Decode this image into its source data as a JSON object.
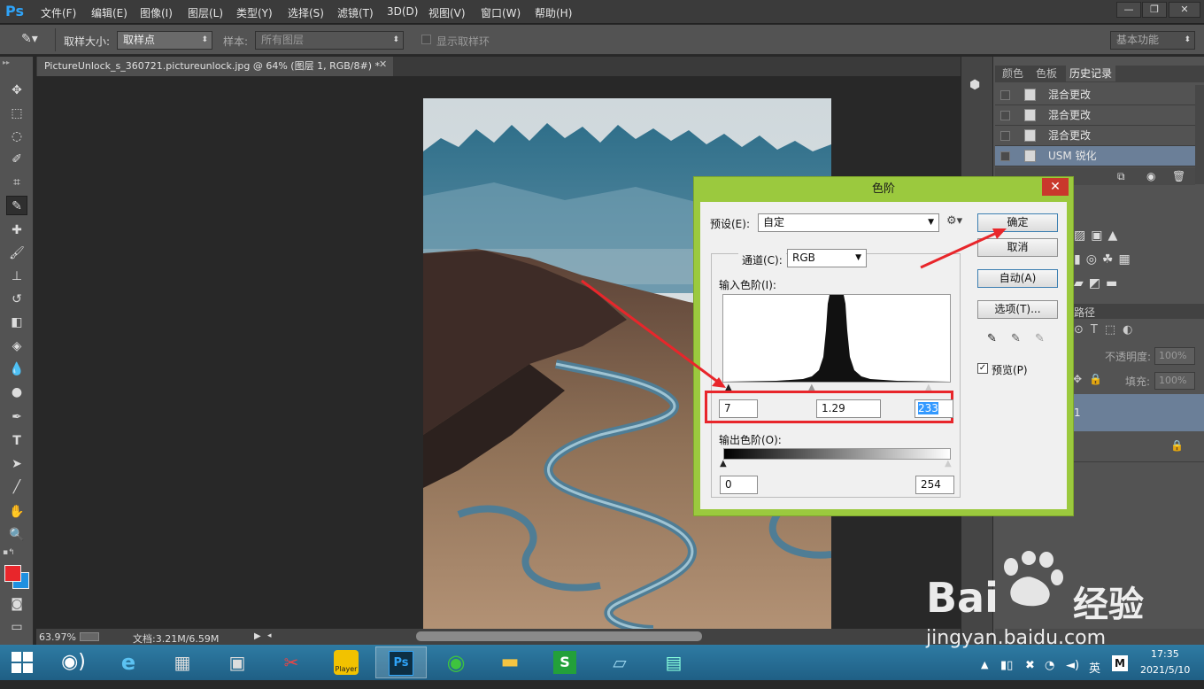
{
  "app": {
    "logo": "Ps"
  },
  "menu": [
    "文件(F)",
    "编辑(E)",
    "图像(I)",
    "图层(L)",
    "类型(Y)",
    "选择(S)",
    "滤镜(T)",
    "3D(D)",
    "视图(V)",
    "窗口(W)",
    "帮助(H)"
  ],
  "options": {
    "sample_size_label": "取样大小:",
    "sample_size_value": "取样点",
    "sample_label": "样本:",
    "sample_value": "所有图层",
    "show_ring_label": "显示取样环",
    "workspace": "基本功能"
  },
  "document": {
    "tab_title": "PictureUnlock_s_360721.pictureunlock.jpg @ 64% (图层 1, RGB/8#) *"
  },
  "status": {
    "zoom": "63.97%",
    "doc_size": "文档:3.21M/6.59M"
  },
  "panels": {
    "tabs": [
      "颜色",
      "色板",
      "历史记录"
    ],
    "history": [
      "混合更改",
      "混合更改",
      "混合更改",
      "USM 锐化"
    ],
    "paths_tab_partial": "路径",
    "opacity_label": "不透明度:",
    "opacity_value": "100%",
    "fill_label": "填充:",
    "fill_value": "100%",
    "layer_name_partial": "1"
  },
  "dialog": {
    "title": "色阶",
    "preset_label": "预设(E):",
    "preset_value": "自定",
    "channel_label": "通道(C):",
    "channel_value": "RGB",
    "input_levels_label": "输入色阶(I):",
    "input_black": "7",
    "input_gamma": "1.29",
    "input_white": "233",
    "output_levels_label": "输出色阶(O):",
    "output_black": "0",
    "output_white": "254",
    "ok_button": "确定",
    "cancel_button": "取消",
    "auto_button": "自动(A)",
    "options_button": "选项(T)...",
    "preview_label": "预览(P)",
    "preview_checked": true
  },
  "taskbar": {
    "time": "17:35",
    "date": "2021/5/10",
    "ime": "英",
    "apps": [
      "windows",
      "media",
      "ie",
      "calculator",
      "monitor",
      "paint",
      "player",
      "photoshop",
      "browser",
      "explorer",
      "sheets",
      "notes",
      "photos"
    ],
    "player_label": "Player"
  },
  "watermark": {
    "brand": "Bai",
    "brand_cn": "经验",
    "url": "jingyan.baidu.com"
  },
  "colors": {
    "dialog_border": "#9bc93e",
    "highlight_red": "#e8262b",
    "fg_swatch": "#e8262b",
    "bg_swatch": "#1e90e0",
    "selection_blue": "#3399ff"
  }
}
